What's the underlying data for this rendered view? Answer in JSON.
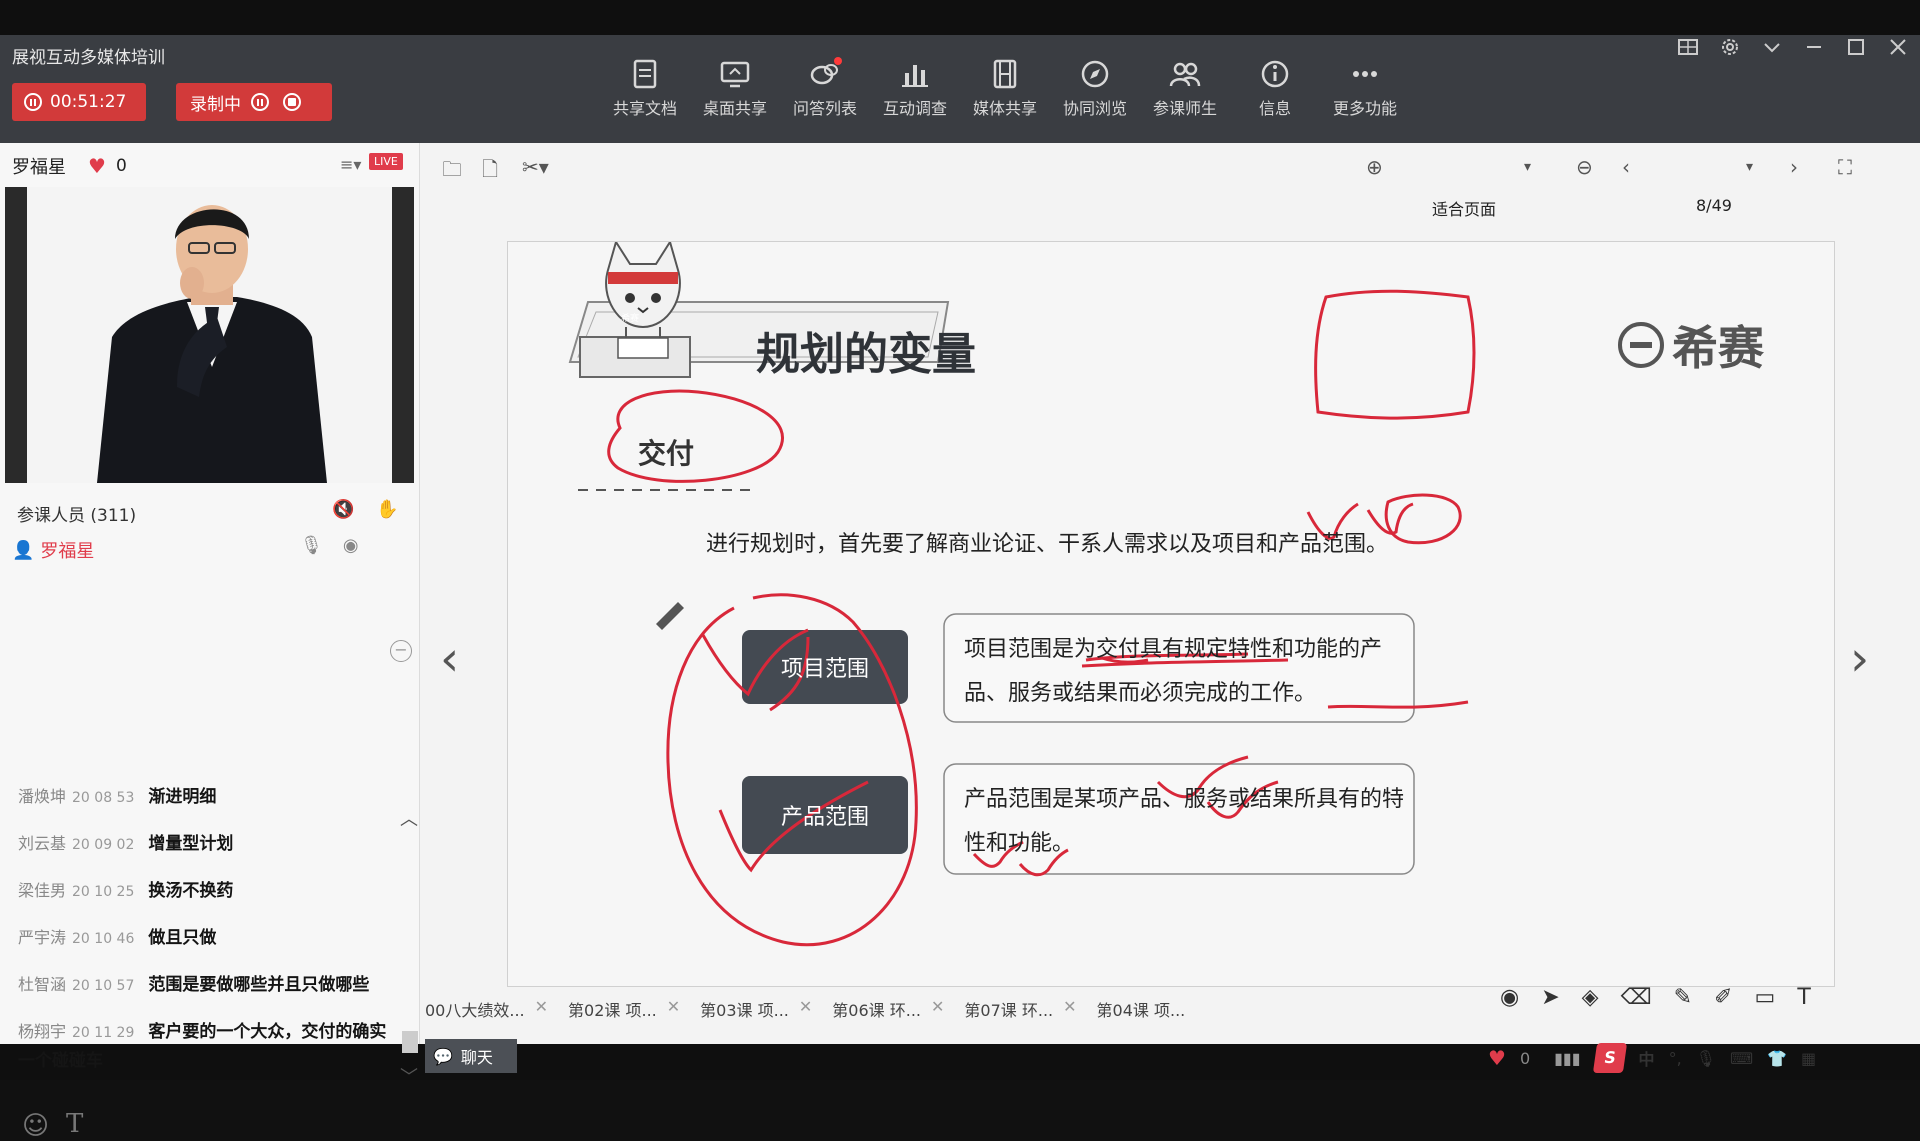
{
  "app": {
    "title": "展视互动多媒体培训",
    "timer": "00:51:27",
    "recording_label": "录制中"
  },
  "toolbar": {
    "items": [
      {
        "label": "共享文档",
        "icon": "document-share-icon"
      },
      {
        "label": "桌面共享",
        "icon": "desktop-share-icon"
      },
      {
        "label": "问答列表",
        "icon": "qa-list-icon"
      },
      {
        "label": "互动调查",
        "icon": "survey-chart-icon"
      },
      {
        "label": "媒体共享",
        "icon": "media-film-icon"
      },
      {
        "label": "协同浏览",
        "icon": "compass-icon"
      },
      {
        "label": "参课师生",
        "icon": "people-icon"
      },
      {
        "label": "信息",
        "icon": "info-icon"
      },
      {
        "label": "更多功能",
        "icon": "more-dots-icon"
      }
    ]
  },
  "host": {
    "name": "罗福星",
    "likes": "0",
    "live": "LIVE"
  },
  "participants": {
    "label": "参课人员 (311)",
    "presenter": "罗福星"
  },
  "chat": {
    "messages": [
      {
        "who": "潘焕坤",
        "time": "20 08 53",
        "text": "渐进明细"
      },
      {
        "who": "刘云基",
        "time": "20 09 02",
        "text": "增量型计划"
      },
      {
        "who": "梁佳男",
        "time": "20 10 25",
        "text": "换汤不换药"
      },
      {
        "who": "严宇涛",
        "time": "20 10 46",
        "text": "做且只做"
      },
      {
        "who": "杜智涵",
        "time": "20 10 57",
        "text": "范围是要做哪些并且只做哪些"
      },
      {
        "who": "杨翔宇",
        "time": "20 11 29",
        "text": "客户要的一个大众，交付的确实一个碰碰车"
      }
    ]
  },
  "doc_toolbar": {
    "zoom_mode": "适合页面",
    "page": "8/49"
  },
  "slide": {
    "title": "规划的变量",
    "logo": "希赛",
    "mascot_band": "希赛",
    "section": "交付",
    "intro": "进行规划时，首先要了解商业论证、干系人需求以及项目和产品范围。",
    "box1_label": "项目范围",
    "box1_desc": "项目范围是为交付具有规定特性和功能的产品、服务或结果而必须完成的工作。",
    "box2_label": "产品范围",
    "box2_desc": "产品范围是某项产品、服务或结果所具有的特性和功能。"
  },
  "tabs": [
    {
      "label": "00八大绩效..."
    },
    {
      "label": "第02课  项..."
    },
    {
      "label": "第03课  项..."
    },
    {
      "label": "第06课  环..."
    },
    {
      "label": "第07课  环..."
    },
    {
      "label": "第04课  项..."
    }
  ],
  "chat_button": "聊天",
  "status": {
    "likes": "0",
    "ime": "中"
  },
  "colors": {
    "topbar": "#3a3d42",
    "accent_red": "#d23a3a",
    "slide_button": "#444a52",
    "annotation_red": "#d8283a"
  }
}
